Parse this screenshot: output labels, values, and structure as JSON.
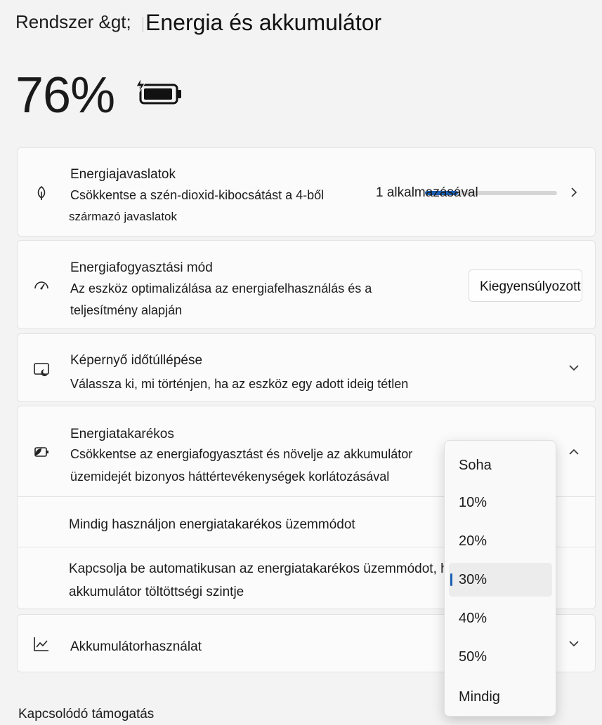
{
  "header": {
    "breadcrumb": "Rendszer &gt;",
    "title": "Energia és akkumulátor"
  },
  "battery": {
    "percent_text": "76%",
    "percent_value": 76,
    "icon": "battery-charging-icon"
  },
  "recommendations": {
    "icon": "leaf-icon",
    "title": "Energiajavaslatok",
    "desc_line1": "Csökkentse a szén-dioxid-kibocsátást a 4-ből",
    "desc_line2": "származó javaslatok",
    "progress_label": "1 alkalmazásával",
    "progress_value": 0.25,
    "chevron": "chevron-right-icon"
  },
  "power_mode": {
    "icon": "gauge-icon",
    "title": "Energiafogyasztási mód",
    "desc_line1": "Az eszköz optimalizálása az energiafelhasználás és a",
    "desc_line2": "teljesítmény alapján",
    "value": "Kiegyensúlyozott"
  },
  "screen_timeout": {
    "icon": "screen-sleep-icon",
    "title": "Képernyő időtúllépése",
    "desc": "Válassza ki, mi történjen, ha az eszköz egy adott ideig tétlen",
    "chevron": "chevron-down-icon"
  },
  "saver": {
    "icon": "battery-saver-icon",
    "title": "Energiatakarékos",
    "desc_line1": "Csökkentse az energiafogyasztást és növelje az akkumulátor",
    "desc_line2": "üzemidejét bizonyos háttértevékenységek korlátozásával",
    "chevron": "chevron-up-icon",
    "always_label": "Mindig használjon energiatakarékos üzemmódot",
    "auto_line1": "Kapcsolja be automatikusan az energiatakarékos üzemmódot, ha az",
    "auto_line2": "akkumulátor töltöttségi szintje"
  },
  "usage": {
    "icon": "chart-icon",
    "title": "Akkumulátorhasználat",
    "chevron": "chevron-down-icon"
  },
  "dropdown": {
    "options": [
      "Soha",
      "10%",
      "20%",
      "30%",
      "40%",
      "50%",
      "Mindig"
    ],
    "selected": "30%"
  },
  "related": "Kapcsolódó támogatás",
  "colors": {
    "accent": "#1a5fb4",
    "background": "#f3f3f3",
    "card": "#fbfbfb"
  }
}
